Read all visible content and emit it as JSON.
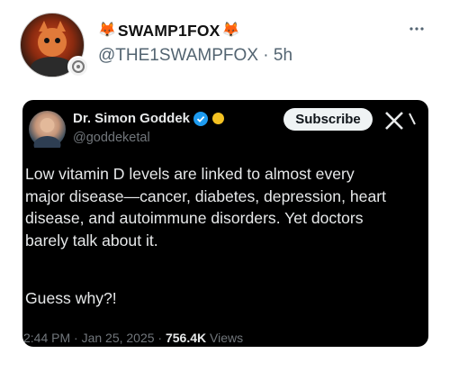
{
  "post": {
    "fox_emoji": "🦊",
    "display_name": "SWAMP1FOX",
    "handle": "@THE1SWAMPFOX",
    "separator": " · ",
    "time_ago": "5h",
    "more_icon": "more-icon"
  },
  "quoted": {
    "name": "Dr. Simon Goddek",
    "handle": "@goddeketal",
    "subscribe_label": "Subscribe",
    "text": "Low vitamin D levels are linked to almost every\nmajor disease—cancer, diabetes, depression, heart\ndisease, and autoimmune disorders. Yet doctors\nbarely talk about it.",
    "text_2": "Guess why?!",
    "time": "2:44 PM · Jan 25, 2025 · ",
    "views_count": "756.4K",
    "views_label": " Views",
    "colors": {
      "background": "#000000",
      "verified": "#1d9bf0",
      "badge": "#f4c222"
    }
  }
}
